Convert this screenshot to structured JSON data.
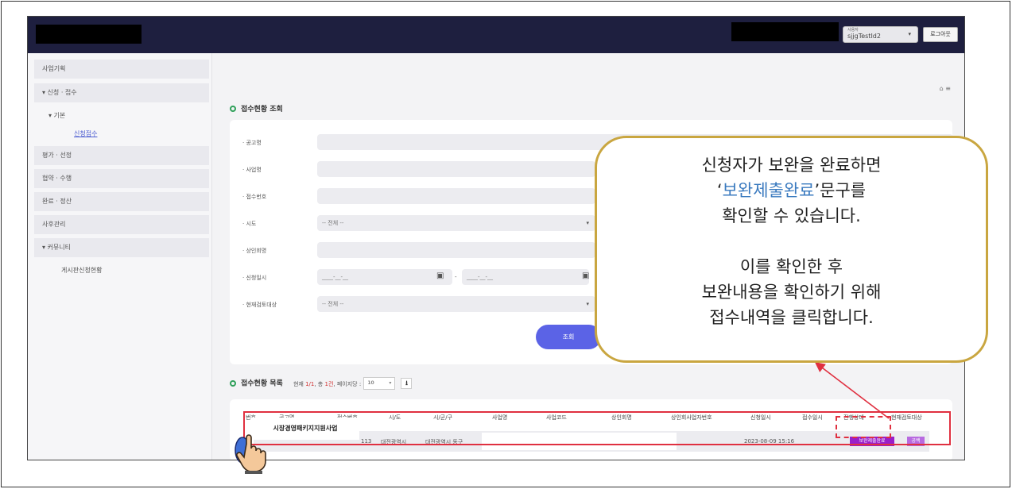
{
  "header": {
    "user_sub": "사용자",
    "user_value": "sjjgTestId2",
    "logout_label": "로그아웃"
  },
  "sidebar": {
    "items": [
      {
        "label": "사업기획"
      },
      {
        "label": "▾  신청 · 접수"
      },
      {
        "label": "평가 · 선정"
      },
      {
        "label": "협약 · 수행"
      },
      {
        "label": "완료 · 정산"
      },
      {
        "label": "사후관리"
      },
      {
        "label": "▾  커뮤니티"
      }
    ],
    "sub_basic": "▾  기본",
    "sub_apply": "신청접수",
    "sub_board": "게시판신청현황"
  },
  "search": {
    "title": "접수현황 조회",
    "labels": [
      "· 공고명",
      "· 사업명",
      "· 접수번호",
      "· 시도",
      "· 상인회명",
      "· 신청일시",
      "· 현재검토대상"
    ],
    "select_all": "-- 전체 --",
    "date_placeholder": "____-__-__",
    "date_sep": "-",
    "search_button": "조회"
  },
  "list": {
    "title": "접수현황 목록",
    "meta_prefix": "현재",
    "meta_page": "1/1",
    "meta_total_prefix": ", 총",
    "meta_total": "1건",
    "meta_per_page": ", 페이지당 :",
    "per_page": "10",
    "headers": [
      "번호",
      "공고명",
      "접수번호",
      "시/도",
      "시/군/구",
      "사업명",
      "사업코드",
      "상인회명",
      "상인회사업자번호",
      "신청일시",
      "접수일시",
      "진행상태",
      "현재검토대상"
    ],
    "row": {
      "name": "시장경영패키지지원사업",
      "receipt_no": "113",
      "sido": "대전광역시",
      "sigungu": "대전광역시 동구",
      "applied_at": "2023-08-09 15:16",
      "status": "보완제출완료",
      "target": "공백"
    }
  },
  "callout": {
    "line1": "신청자가 보완을 완료하면",
    "line2_open": "‘",
    "line2_highlight": "보완제출완료",
    "line2_close": "’문구를",
    "line3": "확인할 수 있습니다.",
    "line4": "이를 확인한 후",
    "line5": "보완내용을 확인하기 위해",
    "line6": "접수내역을 클릭합니다."
  },
  "colors": {
    "topbar": "#1e1f3f",
    "accent": "#5b63e6",
    "status_badge": "#9a1fc9",
    "highlight_red": "#e03040",
    "callout_border": "#c9a640",
    "callout_highlight": "#3a7abf"
  }
}
